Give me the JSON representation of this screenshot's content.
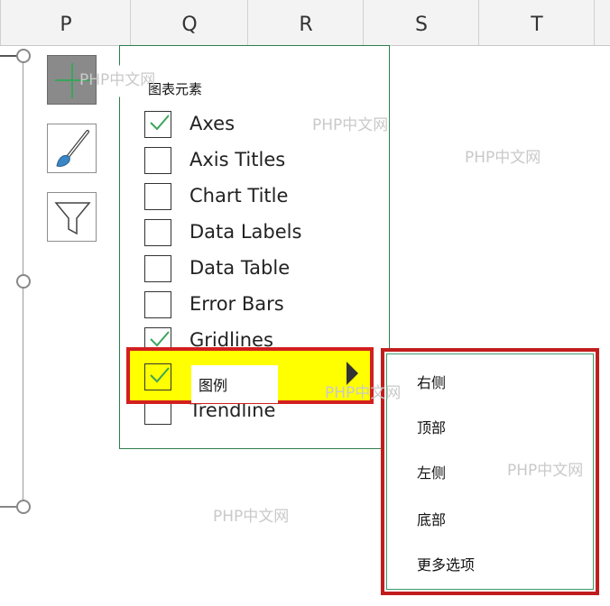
{
  "columns": [
    "P",
    "Q",
    "R",
    "S",
    "T"
  ],
  "side_buttons": [
    {
      "icon": "plus-icon",
      "active": true
    },
    {
      "icon": "paintbrush-icon",
      "active": false
    },
    {
      "icon": "filter-icon",
      "active": false
    }
  ],
  "panel": {
    "title": "图表元素",
    "items": [
      {
        "label": "Axes",
        "checked": true
      },
      {
        "label": "Axis Titles",
        "checked": false
      },
      {
        "label": "Chart Title",
        "checked": false
      },
      {
        "label": "Data Labels",
        "checked": false
      },
      {
        "label": "Data Table",
        "checked": false
      },
      {
        "label": "Error Bars",
        "checked": false
      },
      {
        "label": "Gridlines",
        "checked": true
      }
    ],
    "legend": {
      "label": "图例",
      "checked": true
    },
    "trendline": {
      "label": "Trendline",
      "checked": false
    }
  },
  "submenu": {
    "items": [
      "右侧",
      "顶部",
      "左侧",
      "底部",
      "更多选项"
    ]
  },
  "watermark": "PHP中文网",
  "colors": {
    "highlight": "#ffff00",
    "border_red": "#d21f1f",
    "accent_green": "#2e7d4f",
    "check_green": "#3aa55c"
  }
}
